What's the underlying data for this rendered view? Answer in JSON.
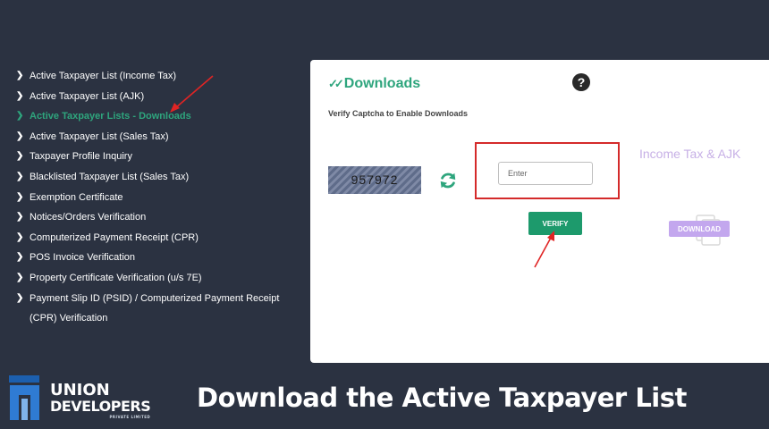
{
  "sidebar": {
    "items": [
      {
        "label": "Active Taxpayer List (Income Tax)"
      },
      {
        "label": "Active Taxpayer List (AJK)"
      },
      {
        "label": "Active Taxpayer Lists - Downloads"
      },
      {
        "label": "Active Taxpayer List (Sales Tax)"
      },
      {
        "label": "Taxpayer Profile Inquiry"
      },
      {
        "label": "Blacklisted Taxpayer List (Sales Tax)"
      },
      {
        "label": "Exemption Certificate"
      },
      {
        "label": "Notices/Orders Verification"
      },
      {
        "label": "Computerized Payment Receipt (CPR)"
      },
      {
        "label": "POS Invoice Verification"
      },
      {
        "label": "Property Certificate Verification (u/s 7E)"
      },
      {
        "label": "Payment Slip ID (PSID) / Computerized Payment Receipt"
      }
    ],
    "last_item_continuation": "(CPR) Verification",
    "active_index": 2
  },
  "panel": {
    "title": "Downloads",
    "help_symbol": "?",
    "caption": "Verify Captcha to Enable Downloads",
    "captcha_code": "957972",
    "input_placeholder": "Enter",
    "verify_label": "VERIFY",
    "download_group_label": "Income Tax & AJK",
    "download_label": "DOWNLOAD"
  },
  "branding": {
    "logo_line1": "UNION",
    "logo_line2": "DEVELOPERS",
    "logo_sub": "PRIVATE LIMITED"
  },
  "caption": "Download the Active Taxpayer List",
  "colors": {
    "background": "#2b3241",
    "accent_green": "#2ea57d",
    "highlight_red": "#d42a2a",
    "download_purple": "#c3a7ee"
  },
  "icons": {
    "title": "check-icon",
    "help": "question-circle-icon",
    "refresh": "refresh-icon",
    "document": "document-icon",
    "chevron": "chevron-right-icon"
  }
}
